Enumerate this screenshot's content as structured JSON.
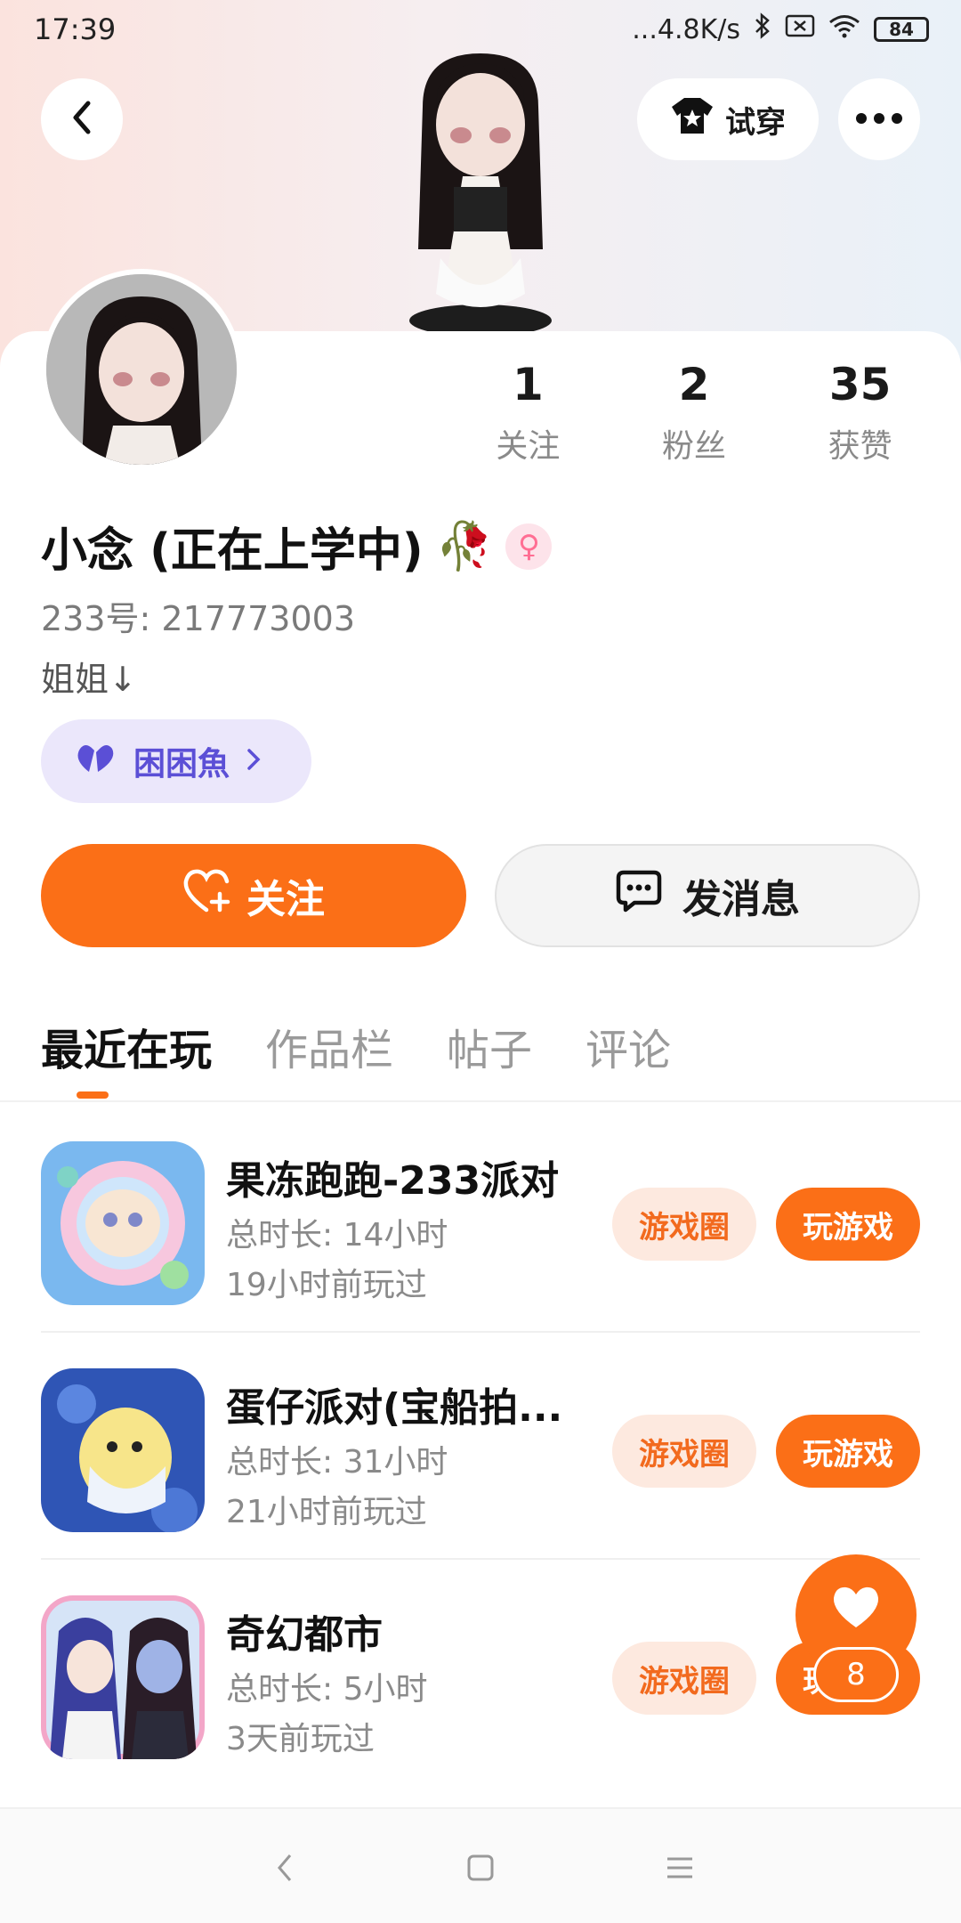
{
  "status_bar": {
    "time": "17:39",
    "network_speed": "...4.8K/s",
    "battery": "84"
  },
  "header": {
    "try_on_label": "试穿"
  },
  "stats": [
    {
      "value": "1",
      "label": "关注"
    },
    {
      "value": "2",
      "label": "粉丝"
    },
    {
      "value": "35",
      "label": "获赞"
    }
  ],
  "profile": {
    "nickname": "小念 (正在上学中)",
    "nickname_emoji": "🥀",
    "gender_symbol": "♀",
    "uid": "233号: 217773003",
    "bio": "姐姐↓",
    "fan_tag": "困困魚"
  },
  "actions": {
    "follow_label": "关注",
    "message_label": "发消息"
  },
  "tabs": [
    "最近在玩",
    "作品栏",
    "帖子",
    "评论"
  ],
  "games": [
    {
      "name": "果冻跑跑-233派对",
      "duration": "总时长: 14小时",
      "last_played": "19小时前玩过",
      "circle_label": "游戏圈",
      "play_label": "玩游戏"
    },
    {
      "name": "蛋仔派对(宝船拍...",
      "duration": "总时长: 31小时",
      "last_played": "21小时前玩过",
      "circle_label": "游戏圈",
      "play_label": "玩游戏"
    },
    {
      "name": "奇幻都市",
      "duration": "总时长: 5小时",
      "last_played": "3天前玩过",
      "circle_label": "游戏圈",
      "play_label": "玩游戏"
    }
  ],
  "floating_like": {
    "count": "8"
  },
  "colors": {
    "accent": "#fb6f17",
    "accent_light": "#fde9df",
    "fan_tag_bg": "#ebe7fb",
    "fan_tag_text": "#5b4fd6"
  }
}
